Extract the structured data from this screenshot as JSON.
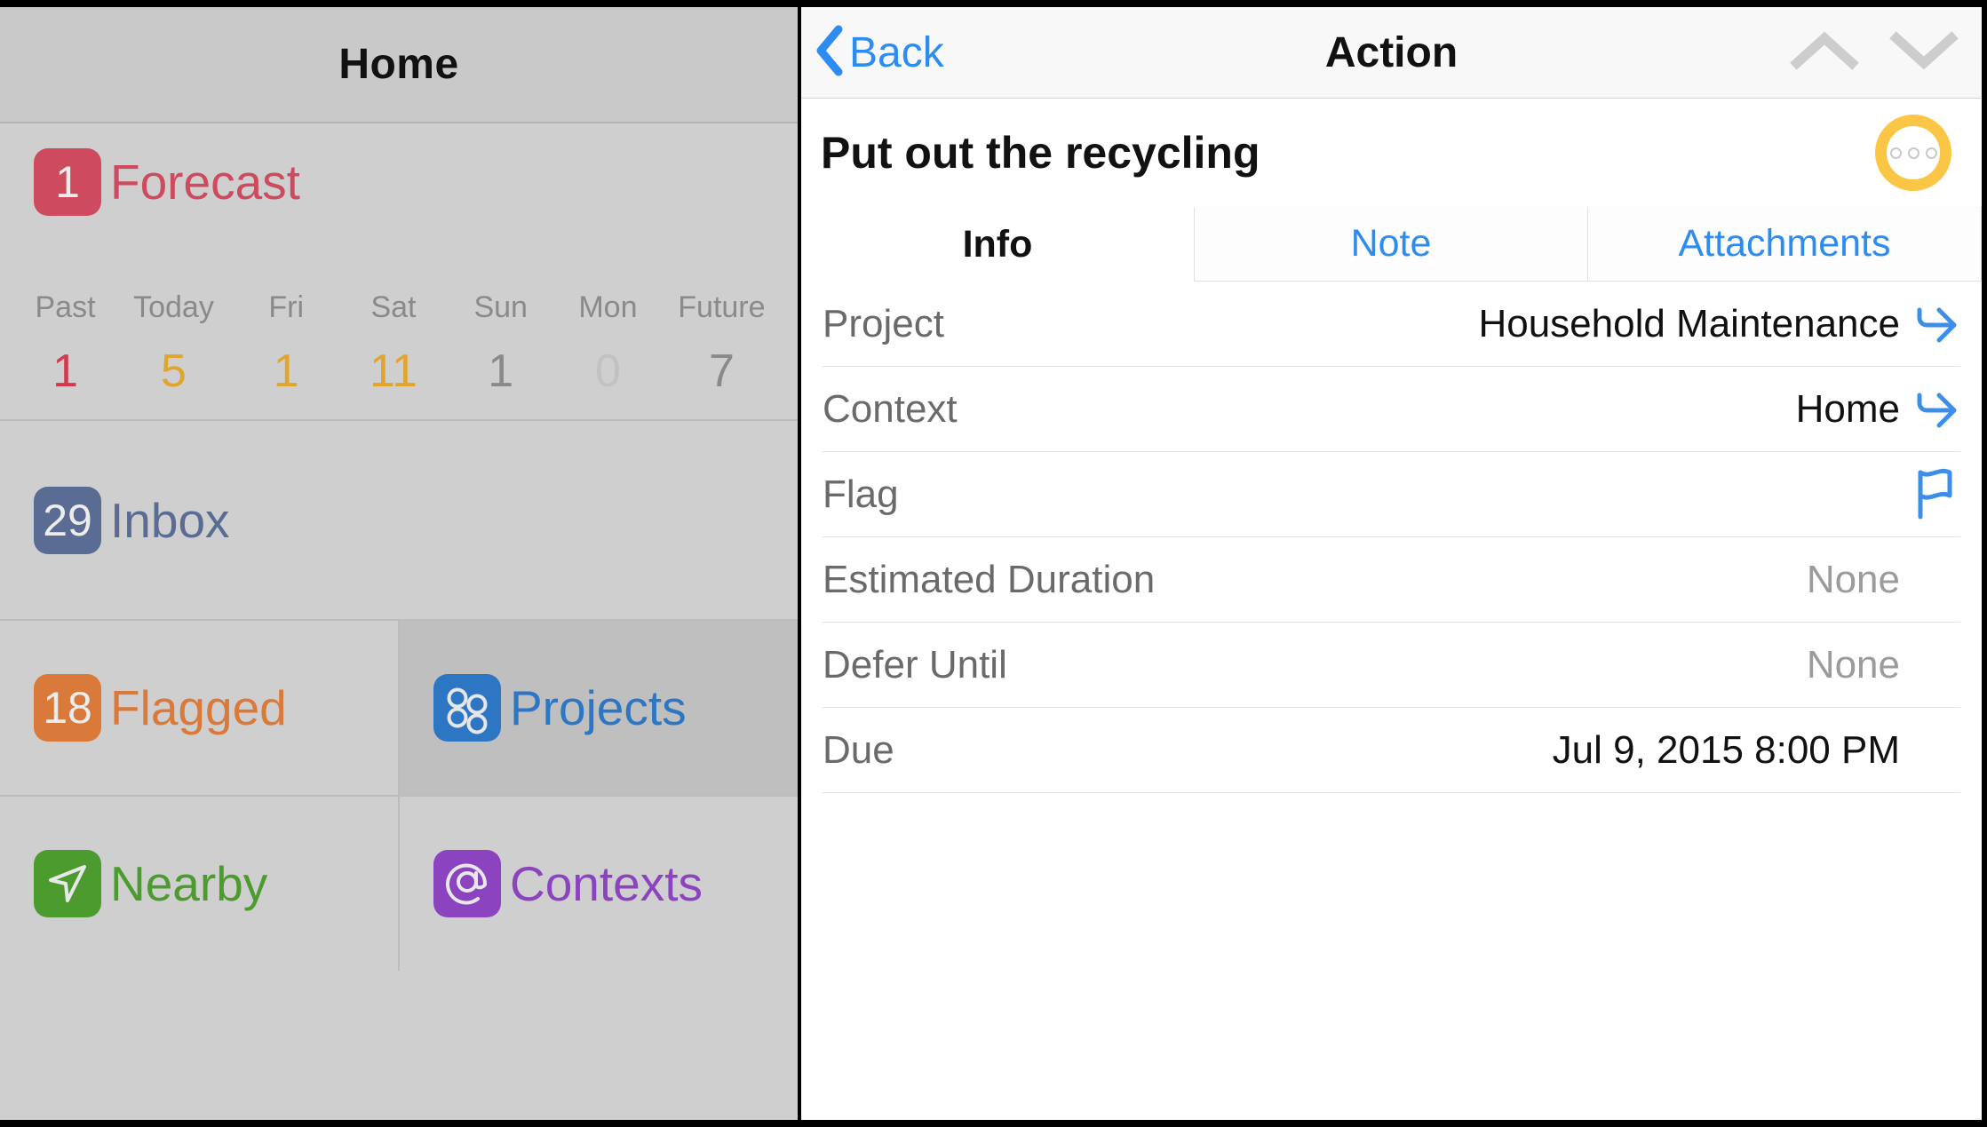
{
  "sidebar": {
    "header_title": "Home",
    "forecast": {
      "badge_count": "1",
      "label": "Forecast",
      "badge_color": "#ce4a5e",
      "label_color": "#ce4a5e",
      "days": [
        {
          "day": "Past",
          "count": "1",
          "color": "#d13a4e"
        },
        {
          "day": "Today",
          "count": "5",
          "color": "#e0a52a"
        },
        {
          "day": "Fri",
          "count": "1",
          "color": "#e0a52a"
        },
        {
          "day": "Sat",
          "count": "11",
          "color": "#e0a52a"
        },
        {
          "day": "Sun",
          "count": "1",
          "color": "#8a8a8a"
        },
        {
          "day": "Mon",
          "count": "0",
          "color": "#c2c2c2"
        },
        {
          "day": "Future",
          "count": "7",
          "color": "#8a8a8a"
        }
      ]
    },
    "inbox": {
      "badge_count": "29",
      "label": "Inbox",
      "badge_color": "#5a6b94",
      "label_color": "#5a6b94"
    },
    "flagged": {
      "badge_count": "18",
      "label": "Flagged",
      "badge_color": "#d9793a",
      "label_color": "#d9793a"
    },
    "projects": {
      "icon": "projects-circles-icon",
      "label": "Projects",
      "tile_color": "#2d76c4",
      "label_color": "#2d76c4",
      "selected": true
    },
    "nearby": {
      "icon": "navigation-arrow-icon",
      "label": "Nearby",
      "tile_color": "#4c9b2e",
      "label_color": "#4c9b2e"
    },
    "contexts": {
      "icon": "at-sign-icon",
      "label": "Contexts",
      "tile_color": "#8b43bf",
      "label_color": "#8b43bf"
    }
  },
  "detail": {
    "header": {
      "back_label": "Back",
      "back_icon": "chevron-left-icon",
      "title": "Action",
      "prev_icon": "chevron-up-icon",
      "next_icon": "chevron-down-icon",
      "accent_color": "#2d8cf0"
    },
    "task": {
      "title": "Put out the recycling",
      "status_icon": "ellipsis-circle-icon",
      "status_color": "#fbc546"
    },
    "tabs": [
      {
        "label": "Info",
        "active": true
      },
      {
        "label": "Note",
        "active": false
      },
      {
        "label": "Attachments",
        "active": false
      }
    ],
    "fields": [
      {
        "label": "Project",
        "value": "Household Maintenance",
        "accessory": "goto-arrow-icon",
        "muted": false
      },
      {
        "label": "Context",
        "value": "Home",
        "accessory": "goto-arrow-icon",
        "muted": false
      },
      {
        "label": "Flag",
        "value": "",
        "accessory": "flag-icon",
        "muted": false
      },
      {
        "label": "Estimated Duration",
        "value": "None",
        "accessory": "",
        "muted": true
      },
      {
        "label": "Defer Until",
        "value": "None",
        "accessory": "",
        "muted": true
      },
      {
        "label": "Due",
        "value": "Jul 9, 2015  8:00 PM",
        "accessory": "",
        "muted": false
      }
    ]
  }
}
